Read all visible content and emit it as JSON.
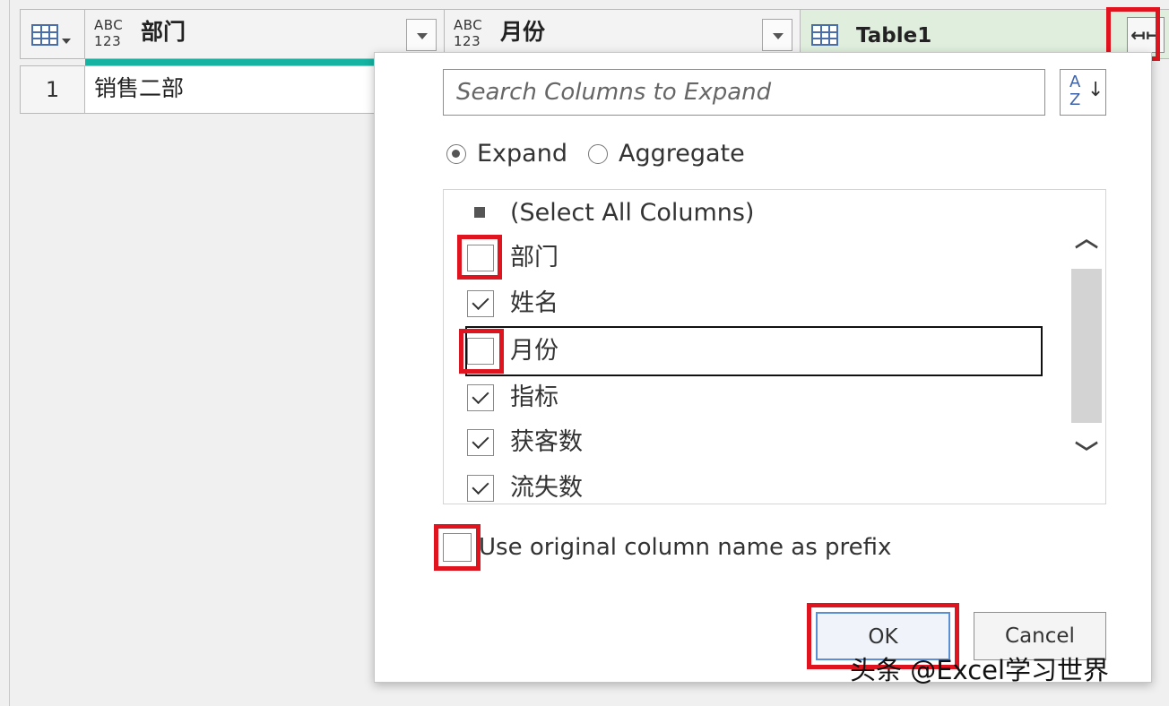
{
  "grid": {
    "columns": [
      {
        "type_icon": "ABC 123",
        "title": "部门"
      },
      {
        "type_icon": "ABC 123",
        "title": "月份"
      },
      {
        "type_icon": "table-icon",
        "title": "Table1"
      }
    ],
    "type_top": "ABC",
    "type_bottom": "123",
    "rows": [
      {
        "num": "1",
        "col1": "销售二部"
      }
    ],
    "expand_icon": "expand-columns-icon"
  },
  "popup": {
    "search_placeholder": "Search Columns to Expand",
    "sort_label": "AZ",
    "sort_a": "A",
    "sort_z": "Z",
    "sort_arrow": "↓",
    "radio_expand": "Expand",
    "radio_aggregate": "Aggregate",
    "selected_mode": "Expand",
    "items": [
      {
        "label": "(Select All Columns)",
        "state": "partial"
      },
      {
        "label": "部门",
        "state": "unchecked"
      },
      {
        "label": "姓名",
        "state": "checked"
      },
      {
        "label": "月份",
        "state": "unchecked"
      },
      {
        "label": "指标",
        "state": "checked"
      },
      {
        "label": "获客数",
        "state": "checked"
      },
      {
        "label": "流失数",
        "state": "checked"
      }
    ],
    "prefix_label": "Use original column name as prefix",
    "prefix_checked": false,
    "ok_label": "OK",
    "cancel_label": "Cancel"
  },
  "watermark": "头条 @Excel学习世界",
  "colors": {
    "highlight_red": "#e0141e",
    "teal_bar": "#16b3a2",
    "table_header_green": "#dfeedd"
  }
}
